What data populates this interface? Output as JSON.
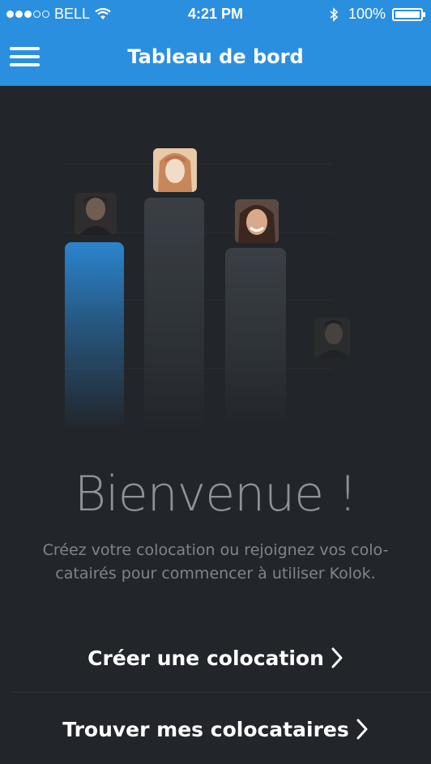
{
  "status_bar": {
    "carrier": "BELL",
    "time": "4:21 PM",
    "battery": "100%",
    "signal_bars_filled": 3,
    "signal_bars_total": 5,
    "icons": [
      "signal-dots",
      "wifi-icon",
      "bluetooth-icon",
      "battery-icon"
    ]
  },
  "nav": {
    "title": "Tableau de bord",
    "menu_icon": "hamburger-icon"
  },
  "welcome": {
    "title": "Bienvenue !",
    "text": "Créez votre colocation ou rejoignez vos colo-catairés pour commencer à utiliser Kolok."
  },
  "actions": {
    "create_label": "Créer une colocation",
    "find_label": "Trouver mes colocataires"
  },
  "colors": {
    "accent": "#2b8fe0",
    "background": "#22262b",
    "text_muted": "#7f858b"
  }
}
